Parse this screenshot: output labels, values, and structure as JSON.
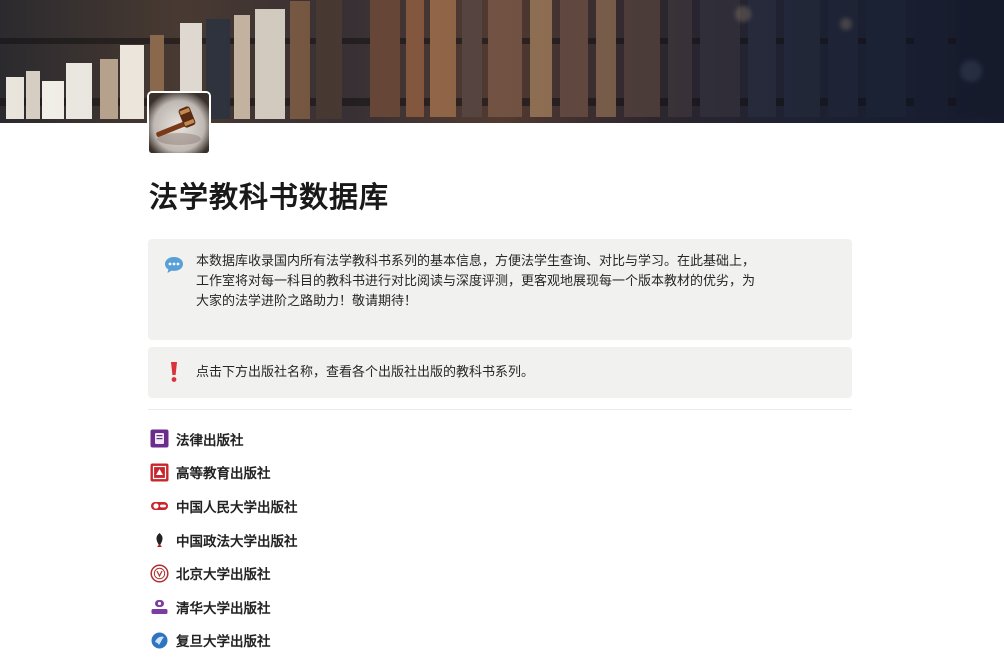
{
  "page": {
    "title": "法学教科书数据库"
  },
  "callouts": [
    {
      "icon": "speech-bubble-icon",
      "lines": [
        "本数据库收录国内所有法学教科书系列的基本信息，方便法学生查询、对比与学习。在此基础上，",
        "工作室将对每一科目的教科书进行对比阅读与深度评测，更客观地展现每一个版本教材的优劣，为",
        "大家的法学进阶之路助力！敬请期待！"
      ]
    },
    {
      "icon": "exclamation-icon",
      "text": "点击下方出版社名称，查看各个出版社出版的教科书系列。"
    }
  ],
  "publishers": [
    {
      "label": "法律出版社",
      "icon": "law-press-logo-icon"
    },
    {
      "label": "高等教育出版社",
      "icon": "higher-education-press-logo-icon"
    },
    {
      "label": "中国人民大学出版社",
      "icon": "renmin-university-press-logo-icon"
    },
    {
      "label": "中国政法大学出版社",
      "icon": "cupl-press-logo-icon"
    },
    {
      "label": "北京大学出版社",
      "icon": "peking-university-press-logo-icon"
    },
    {
      "label": "清华大学出版社",
      "icon": "tsinghua-university-press-logo-icon"
    },
    {
      "label": "复旦大学出版社",
      "icon": "fudan-university-press-logo-icon"
    }
  ],
  "colors": {
    "callout_bg": "#f1f1ef",
    "speech_bubble": "#5aa0d8",
    "exclamation": "#d9323a",
    "law_press": "#6a2d8c",
    "higher_edu": "#c8262c",
    "renmin": "#c8262c",
    "cupl": "#222222",
    "pku": "#b03030",
    "tsinghua": "#7a3ea0",
    "fudan": "#2f74c0"
  }
}
